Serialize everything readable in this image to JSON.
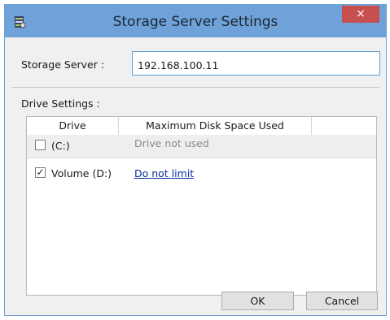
{
  "window": {
    "title": "Storage Server Settings",
    "close_label": "×",
    "app_icon": "server-settings-icon"
  },
  "server": {
    "label": "Storage Server :",
    "value": "192.168.100.11"
  },
  "drive_settings": {
    "label": "Drive Settings :",
    "columns": [
      "Drive",
      "Maximum Disk Space Used"
    ],
    "rows": [
      {
        "checked": false,
        "drive": "(C:)",
        "usage": "Drive not used"
      },
      {
        "checked": true,
        "drive": "Volume (D:)",
        "usage": "Do not limit"
      }
    ]
  },
  "buttons": {
    "ok": "OK",
    "cancel": "Cancel"
  },
  "colors": {
    "titlebar": "#6fa2d8",
    "close": "#c7504f",
    "link": "#0a2fa0"
  }
}
